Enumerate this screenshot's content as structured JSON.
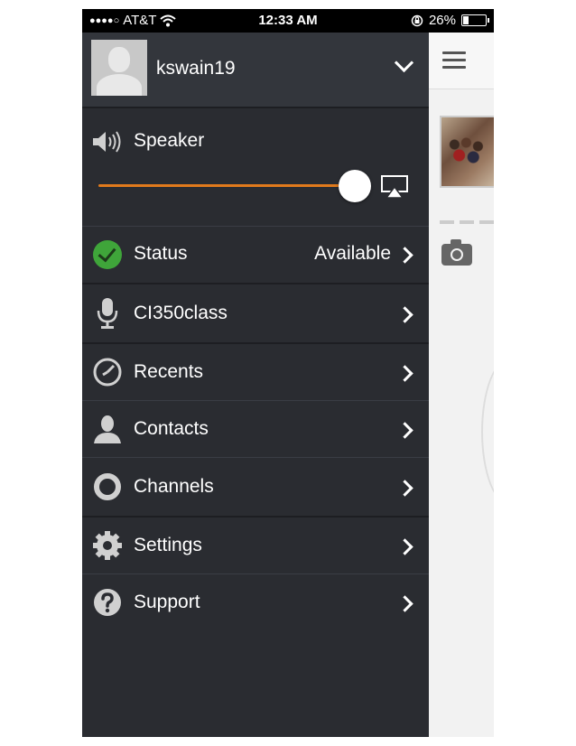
{
  "status_bar": {
    "carrier": "AT&T",
    "time": "12:33 AM",
    "battery": "26%",
    "battery_level": 0.26
  },
  "user": {
    "username": "kswain19"
  },
  "speaker": {
    "label": "Speaker",
    "volume_level": 1.0
  },
  "colors": {
    "slider_accent": "#e07a1c",
    "status_available": "#3fa53a"
  },
  "menu": {
    "status": {
      "label": "Status",
      "value": "Available",
      "icon": "check-circle-icon"
    },
    "channel": {
      "label": "CI350class",
      "icon": "microphone-icon"
    },
    "recents": {
      "label": "Recents",
      "icon": "clock-icon"
    },
    "contacts": {
      "label": "Contacts",
      "icon": "person-icon"
    },
    "channels": {
      "label": "Channels",
      "icon": "ring-icon"
    },
    "settings": {
      "label": "Settings",
      "icon": "gear-icon"
    },
    "support": {
      "label": "Support",
      "icon": "question-icon"
    }
  }
}
